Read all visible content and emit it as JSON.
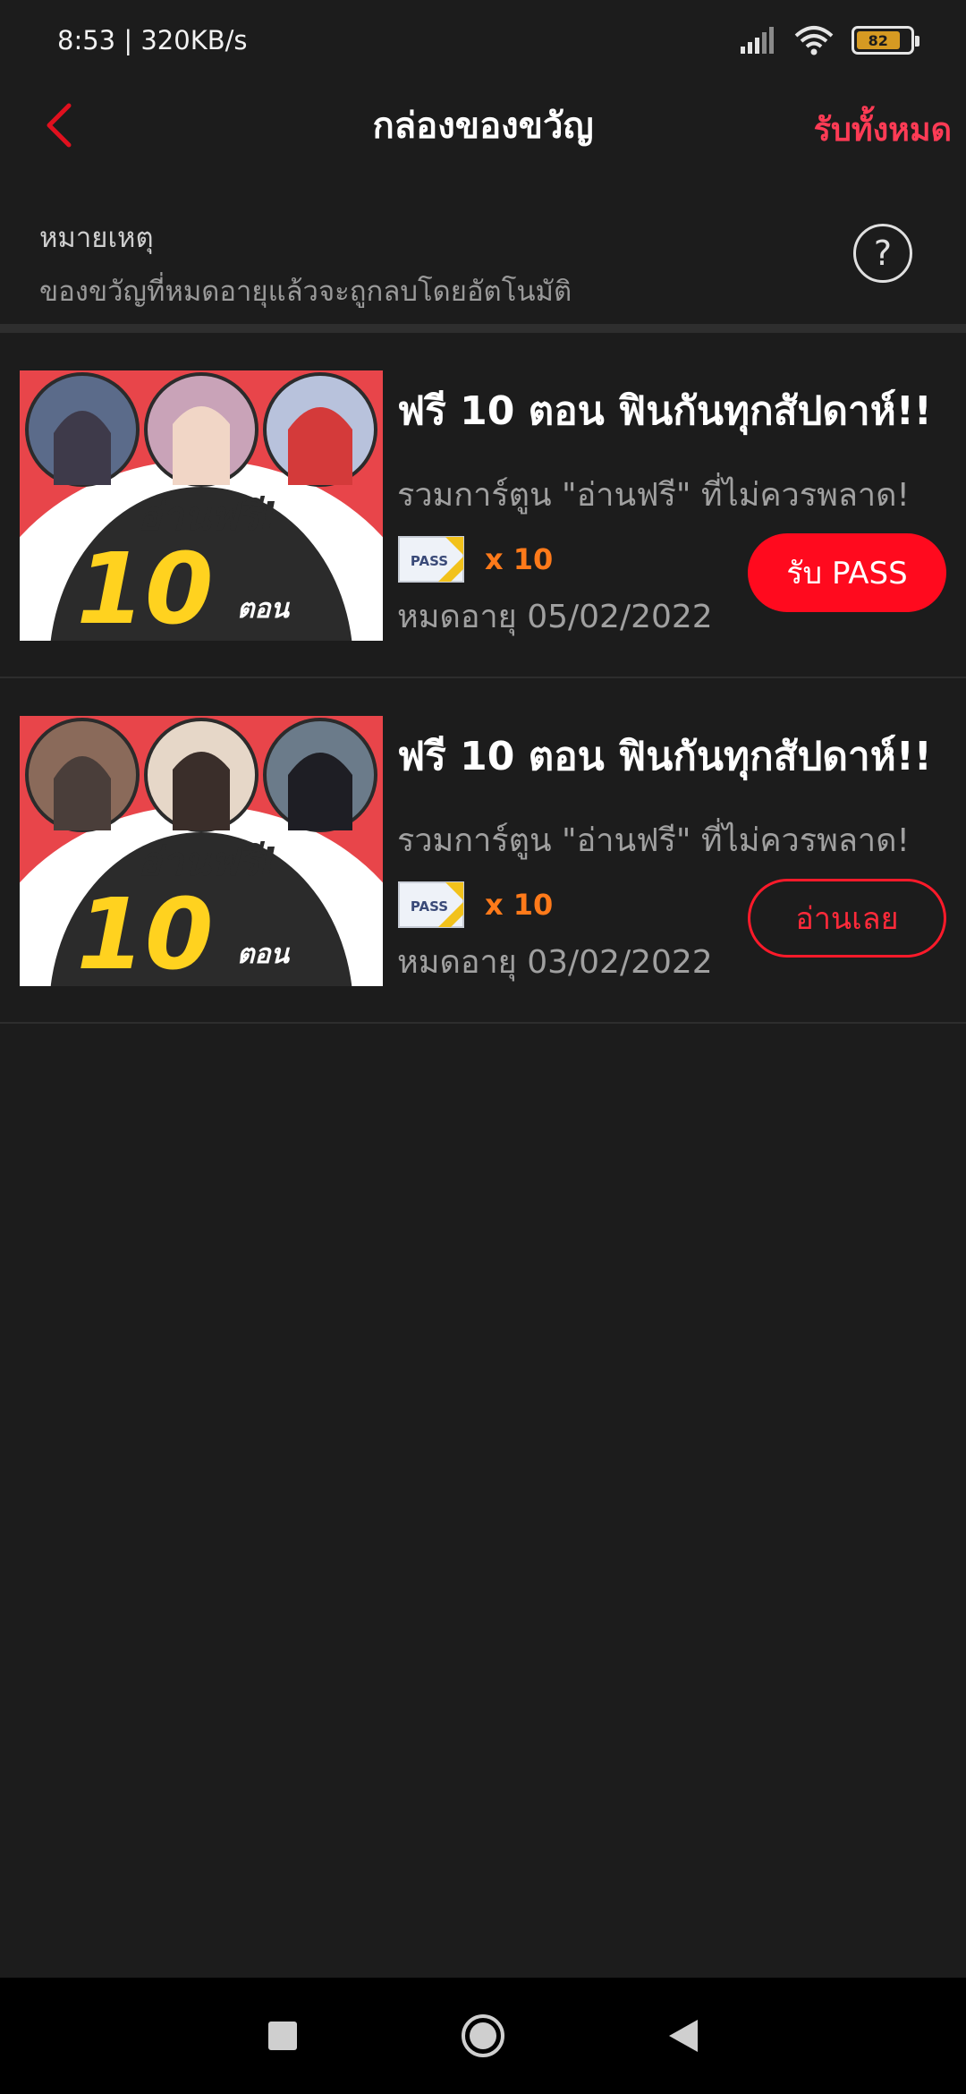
{
  "status_bar": {
    "time": "8:53",
    "net_speed": "320KB/s",
    "battery": "82",
    "battery_level": 0.82
  },
  "header": {
    "title": "กล่องของขวัญ",
    "claim_all": "รับทั้งหมด",
    "back_icon": "chevron-left-icon"
  },
  "notice": {
    "title": "หมายเหตุ",
    "text": "ของขวัญที่หมดอายุแล้วจะถูกลบโดยอัตโนมัติ",
    "help_symbol": "?"
  },
  "banner": {
    "headline": "อ่านฟรี!",
    "number": "10",
    "unit": "ตอน"
  },
  "gifts": [
    {
      "title": "ฟรี 10 ตอน ฟินกันทุกสัปดาห์!!",
      "subtitle": "รวมการ์ตูน \"อ่านฟรี\" ที่ไม่ควรพลาด!",
      "pass_label": "PASS",
      "pass_count": "x 10",
      "expiry": "หมดอายุ 05/02/2022",
      "action_label": "รับ PASS",
      "action_type": "claim"
    },
    {
      "title": "ฟรี 10 ตอน ฟินกันทุกสัปดาห์!!",
      "subtitle": "รวมการ์ตูน \"อ่านฟรี\" ที่ไม่ควรพลาด!",
      "pass_label": "PASS",
      "pass_count": "x 10",
      "expiry": "หมดอายุ 03/02/2022",
      "action_label": "อ่านเลย",
      "action_type": "read"
    }
  ],
  "colors": {
    "background": "#1c1c1c",
    "accent_red": "#ff0a1e",
    "claim_all_pink": "#ff3b55",
    "pass_orange": "#ff7a1a",
    "banner_red": "#e8454a",
    "banner_yellow": "#ffd21f"
  }
}
